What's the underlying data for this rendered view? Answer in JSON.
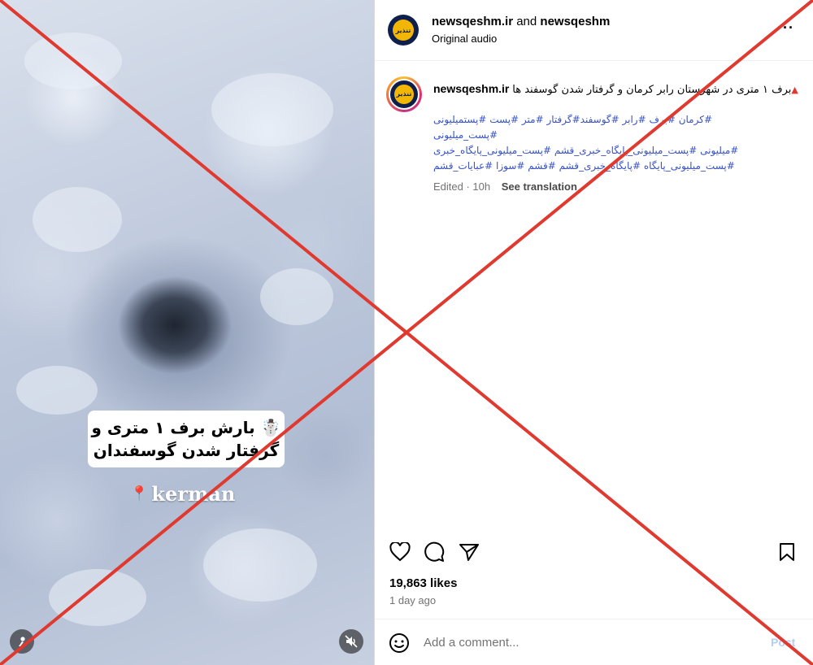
{
  "video": {
    "caption_line1": "☃️ بارش برف ۱ متری و",
    "caption_line2": "گرفتار شدن گوسفندان",
    "location_pin": "📍",
    "location": "kerman",
    "audio_icon": "person-icon",
    "mute_icon": "speaker-muted-icon"
  },
  "header": {
    "account1": "newsqeshm.ir",
    "joiner": "and",
    "account2": "newsqeshm",
    "subtitle": "Original audio",
    "more_label": "···",
    "avatar_text": "تنذیر"
  },
  "caption": {
    "username": "newsqeshm.ir",
    "marker": "▲",
    "text": "برف ۱ متری در شهرستان رابر کرمان و گرفتار شدن گوسفند ها",
    "hashtags_line1": "#کرمان #برف #رابر #گوسفند#گرفتار #متر #پست #پستمیلیونی #پست_میلیونی",
    "hashtags_line2": "#میلیونی #پست_میلیونی_پایگاه_خبری_قشم #پست_میلیونی_پایگاه_خبری",
    "hashtags_line3": "#پست_میلیونی_پایگاه #پایگاه_خبری_قشم #قشم #سوزا #عبایات_قشم",
    "edited": "Edited · 10h",
    "see_translation": "See translation"
  },
  "actions": {
    "like_icon": "heart-icon",
    "comment_icon": "comment-icon",
    "share_icon": "send-icon",
    "save_icon": "bookmark-icon"
  },
  "stats": {
    "likes": "19,863 likes",
    "age": "1 day ago"
  },
  "comment": {
    "placeholder": "Add a comment...",
    "post_label": "Post",
    "emoji_icon": "smiley-icon"
  },
  "colors": {
    "x_overlay": "#e0392f",
    "hashtag": "#3852c7",
    "post_button": "#b3cdf5"
  }
}
